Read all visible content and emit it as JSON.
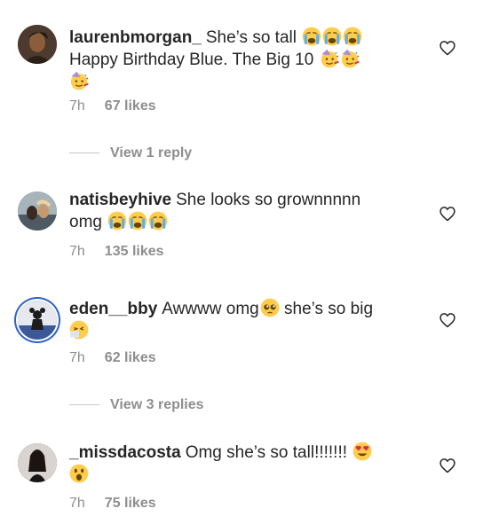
{
  "comments": [
    {
      "username": "laurenbmorgan_",
      "line1": "She’s so tall",
      "line2": "Happy Birthday Blue. The Big 10",
      "time": "7h",
      "likes": "67 likes",
      "line1_emojis": [
        "loudly-crying-face-emoji",
        "loudly-crying-face-emoji",
        "loudly-crying-face-emoji"
      ],
      "line2_emojis": [
        "partying-face-emoji",
        "partying-face-emoji",
        "partying-face-emoji"
      ],
      "avatar_color": "#5a4636"
    },
    {
      "username": "natisbeyhive",
      "line1": "She looks so grownnnnn",
      "line2": "omg",
      "time": "7h",
      "likes": "135 likes",
      "line2_emojis": [
        "loudly-crying-face-emoji",
        "loudly-crying-face-emoji",
        "loudly-crying-face-emoji"
      ],
      "avatar_color": "#6b7f8c"
    },
    {
      "username": "eden__bby",
      "line1": "Awwww omg",
      "line1_after": "she’s so big",
      "time": "7h",
      "likes": "62 likes",
      "line1_emojis": [
        "pleading-face-emoji"
      ],
      "line2_emojis": [
        "sneezing-face-emoji"
      ],
      "avatar_color": "#4a5f8f"
    },
    {
      "username": "_missdacosta",
      "line1": "Omg she’s so tall!!!!!!!",
      "time": "7h",
      "likes": "75 likes",
      "line1_emojis": [
        "heart-eyes-emoji"
      ],
      "line2_emojis": [
        "face-with-open-mouth-emoji"
      ],
      "avatar_color": "#3b3b3b"
    }
  ],
  "replies": [
    {
      "label": "View 1 reply"
    },
    {
      "label": "View 3 replies"
    }
  ],
  "colors": {
    "text": "#262626",
    "meta": "#8e8e8e",
    "divider": "#c7c7c7",
    "emoji_yellow": "#ffcc4d",
    "tear_blue": "#5dadec"
  }
}
